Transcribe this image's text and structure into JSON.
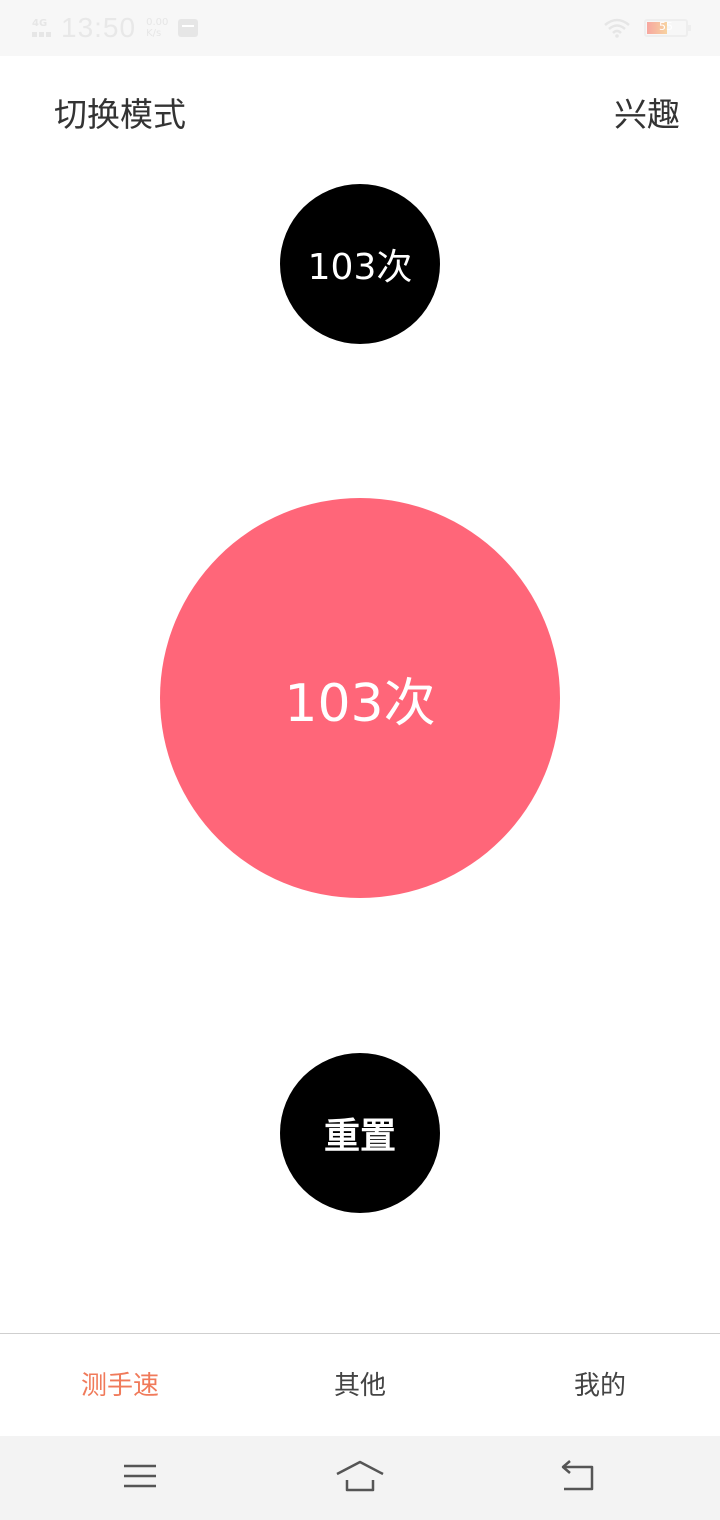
{
  "status_bar": {
    "network_label": "4G",
    "time": "13:50",
    "speed_value": "0.00",
    "speed_unit": "K/s",
    "battery_level": "55"
  },
  "header": {
    "switch_mode_label": "切换模式",
    "interest_label": "兴趣"
  },
  "counter": {
    "count_display": "103次",
    "tap_display": "103次",
    "reset_label": "重置"
  },
  "tabs": [
    {
      "label": "测手速",
      "active": true
    },
    {
      "label": "其他",
      "active": false
    },
    {
      "label": "我的",
      "active": false
    }
  ],
  "colors": {
    "tap_circle": "#ff6679",
    "active_tab": "#f07a5a",
    "dark_circle": "#000000"
  },
  "icons": {
    "nav_menu": "menu-icon",
    "nav_home": "home-icon",
    "nav_back": "back-icon"
  }
}
